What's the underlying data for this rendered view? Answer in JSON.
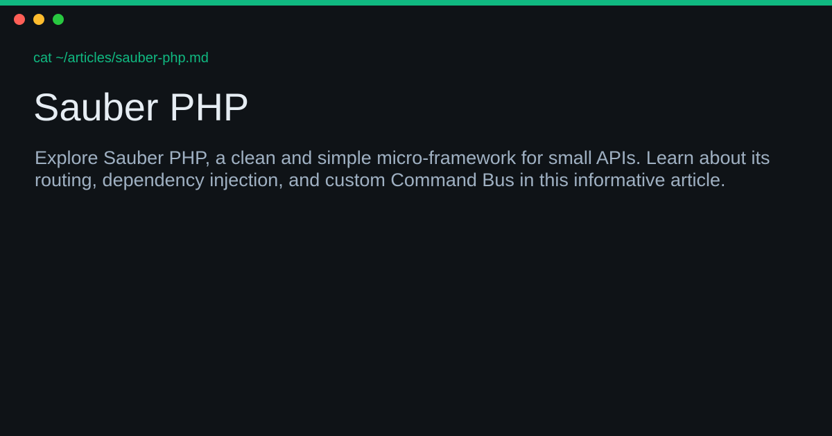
{
  "window": {
    "controls": [
      "close-control",
      "minimize-control",
      "maximize-control"
    ],
    "accent_color": "#10b981",
    "background_color": "#0f1317",
    "control_colors": {
      "close": "#ff5f57",
      "minimize": "#febc2e",
      "maximize": "#28c840"
    }
  },
  "terminal": {
    "command": "cat ~/articles/sauber-php.md"
  },
  "article": {
    "title": "Sauber PHP",
    "description": "Explore Sauber PHP, a clean and simple micro-framework for small APIs. Learn about its routing, dependency injection, and custom Command Bus in this informative article."
  }
}
